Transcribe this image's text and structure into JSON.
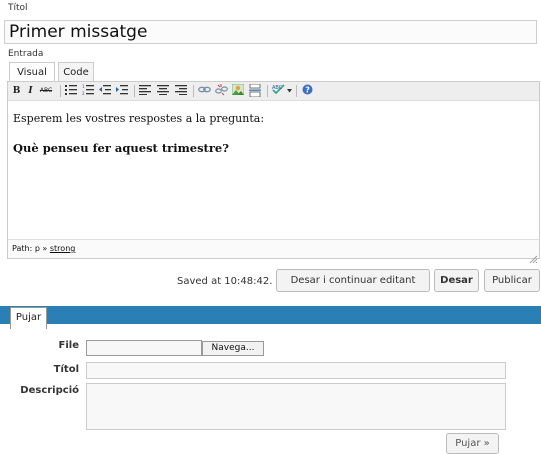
{
  "post": {
    "title_label": "Títol",
    "title_value": "Primer missatge",
    "entry_label": "Entrada"
  },
  "editor": {
    "tabs": [
      {
        "label": "Visual"
      },
      {
        "label": "Code"
      }
    ],
    "toolbar": {
      "bold": "B",
      "italic": "I",
      "strike": "ABC",
      "icons": [
        "bold-icon",
        "italic-icon",
        "strikethrough-icon",
        "bullet-list-icon",
        "numbered-list-icon",
        "outdent-icon",
        "indent-icon",
        "align-left-icon",
        "align-center-icon",
        "align-right-icon",
        "link-icon",
        "unlink-icon",
        "image-icon",
        "more-tag-icon",
        "spellcheck-icon",
        "dropdown-arrow-icon",
        "help-icon"
      ]
    },
    "content": {
      "line1": "Esperem les vostres respostes a la pregunta:",
      "line2": "Què penseu fer aquest trimestre?"
    },
    "path": {
      "prefix": "Path: p » ",
      "strong": "strong"
    }
  },
  "actions": {
    "saved_text": "Saved at 10:48:42.",
    "save_continue_label": "Desar i continuar editant",
    "save_label": "Desar",
    "publish_label": "Publicar"
  },
  "upload": {
    "tab_label": "Pujar",
    "file_label": "File",
    "browse_label": "Navega...",
    "title_label": "Títol",
    "description_label": "Descripció",
    "submit_label": "Pujar »"
  }
}
